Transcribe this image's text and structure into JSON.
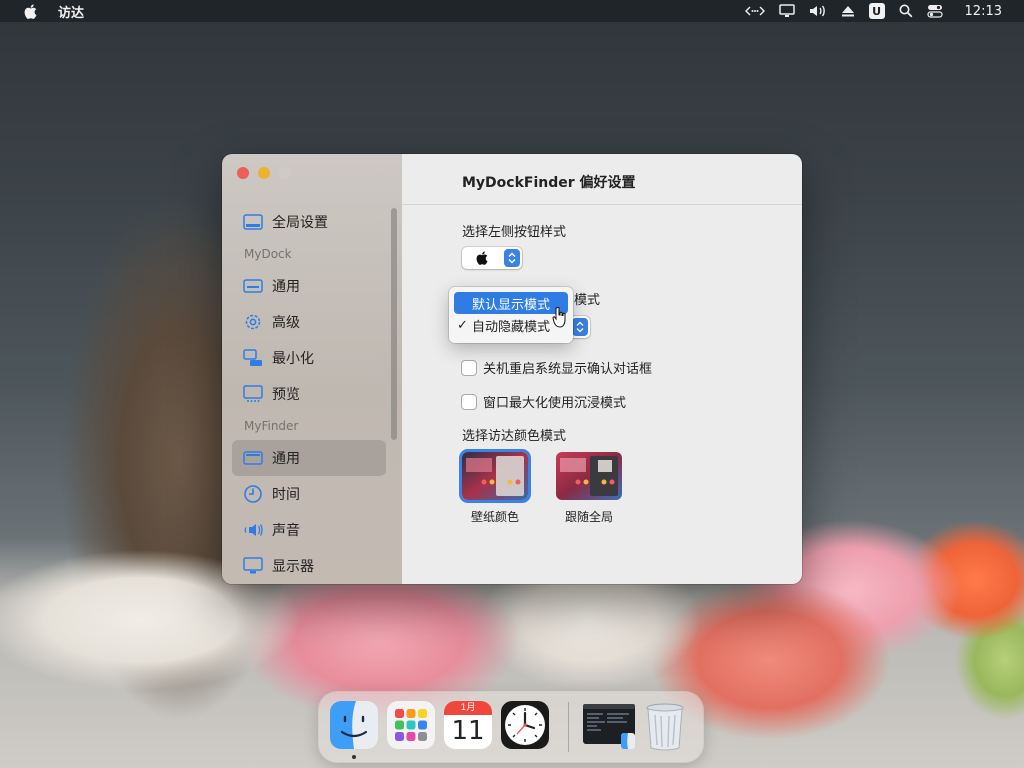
{
  "menubar": {
    "app_name": "访达",
    "clock": "12:13",
    "icons": [
      "apple-icon",
      "network-arrows-icon",
      "display-icon",
      "volume-icon",
      "eject-icon",
      "u-badge-icon",
      "search-icon",
      "control-center-icon"
    ],
    "u_badge": "U"
  },
  "window": {
    "title": "MyDockFinder 偏好设置",
    "sidebar": {
      "global": "全局设置",
      "section_mydock": "MyDock",
      "mydock_items": [
        {
          "label": "通用",
          "icon": "keyboard-icon"
        },
        {
          "label": "高级",
          "icon": "gear-icon"
        },
        {
          "label": "最小化",
          "icon": "minimize-icon"
        },
        {
          "label": "预览",
          "icon": "preview-icon"
        }
      ],
      "section_myfinder": "MyFinder",
      "myfinder_items": [
        {
          "label": "通用",
          "icon": "window-icon",
          "active": true
        },
        {
          "label": "时间",
          "icon": "clock-icon"
        },
        {
          "label": "声音",
          "icon": "speaker-icon"
        },
        {
          "label": "显示器",
          "icon": "monitor-icon"
        }
      ]
    },
    "content": {
      "left_button_style_label": "选择左侧按钮样式",
      "left_button_style_value": "",
      "dock_mode_label_tail": "模式",
      "dock_mode_options": [
        {
          "label": "默认显示模式",
          "highlighted": true,
          "checked": false
        },
        {
          "label": "自动隐藏模式",
          "highlighted": false,
          "checked": true
        }
      ],
      "checkmark": "✓",
      "checkbox_restart": "关机重启系统显示确认对话框",
      "checkbox_maximize": "窗口最大化使用沉浸模式",
      "finder_color_label": "选择访达颜色模式",
      "color_modes": [
        {
          "label": "壁纸颜色",
          "selected": true
        },
        {
          "label": "跟随全局",
          "selected": false
        }
      ]
    }
  },
  "dock": {
    "apps": [
      "finder-icon",
      "launchpad-icon",
      "calendar-icon",
      "clock-app-icon",
      "terminal-finder-icon",
      "trash-icon"
    ],
    "calendar_month": "1月",
    "calendar_day": "11"
  },
  "colors": {
    "accent": "#3b82e6",
    "menu_highlight": "#2f7de4",
    "traffic_red": "#ec5f57",
    "traffic_yellow": "#ecb32f"
  }
}
